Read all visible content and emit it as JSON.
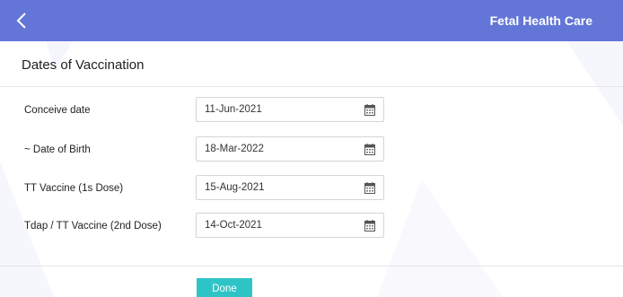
{
  "header": {
    "title": "Fetal Health Care",
    "back_icon": "chevron-left-icon",
    "background_color": "#6376d8"
  },
  "section": {
    "title": "Dates of Vaccination"
  },
  "fields": [
    {
      "label": "Conceive date",
      "value": "11-Jun-2021",
      "icon": "calendar-icon"
    },
    {
      "label": "~ Date of Birth",
      "value": "18-Mar-2022",
      "icon": "calendar-icon"
    },
    {
      "label": "TT Vaccine (1s Dose)",
      "value": "15-Aug-2021",
      "icon": "calendar-icon"
    },
    {
      "label": "Tdap / TT Vaccine (2nd Dose)",
      "value": "14-Oct-2021",
      "icon": "calendar-icon"
    }
  ],
  "actions": {
    "done_label": "Done",
    "done_color": "#2ec4c6"
  }
}
